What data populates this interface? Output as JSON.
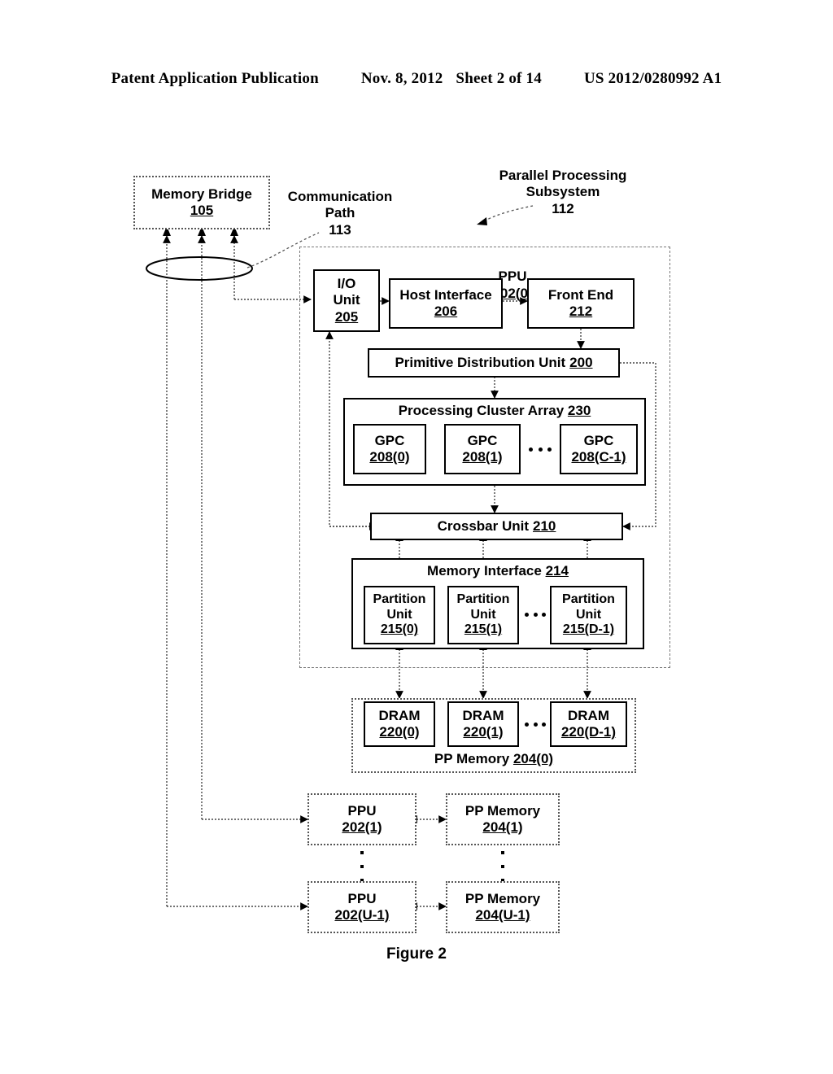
{
  "header": {
    "publication": "Patent Application Publication",
    "date": "Nov. 8, 2012",
    "sheet": "Sheet 2 of 14",
    "doc_number": "US 2012/0280992 A1"
  },
  "figure": {
    "caption": "Figure 2"
  },
  "labels": {
    "communication_path": "Communication\nPath\n113",
    "parallel_processing_subsystem": "Parallel Processing\nSubsystem\n112"
  },
  "blocks": {
    "memory_bridge": {
      "name": "Memory Bridge",
      "ref": "105"
    },
    "ppu_container": {
      "name": "PPU",
      "ref": "202(0)"
    },
    "io_unit": {
      "name": "I/O\nUnit",
      "ref": "205"
    },
    "host_interface": {
      "name": "Host Interface",
      "ref": "206"
    },
    "front_end": {
      "name": "Front End",
      "ref": "212"
    },
    "primitive_distribution_unit": {
      "name": "Primitive Distribution Unit",
      "ref": "200"
    },
    "processing_cluster_array": {
      "name": "Processing Cluster Array",
      "ref": "230"
    },
    "gpc_0": {
      "name": "GPC",
      "ref": "208(0)"
    },
    "gpc_1": {
      "name": "GPC",
      "ref": "208(1)"
    },
    "gpc_c1": {
      "name": "GPC",
      "ref": "208(C-1)"
    },
    "crossbar_unit": {
      "name": "Crossbar Unit",
      "ref": "210"
    },
    "memory_interface": {
      "name": "Memory Interface",
      "ref": "214"
    },
    "partition_0": {
      "name": "Partition\nUnit",
      "ref": "215(0)"
    },
    "partition_1": {
      "name": "Partition\nUnit",
      "ref": "215(1)"
    },
    "partition_d1": {
      "name": "Partition\nUnit",
      "ref": "215(D-1)"
    },
    "dram_0": {
      "name": "DRAM",
      "ref": "220(0)"
    },
    "dram_1": {
      "name": "DRAM",
      "ref": "220(1)"
    },
    "dram_d1": {
      "name": "DRAM",
      "ref": "220(D-1)"
    },
    "pp_memory_0": {
      "name": "PP Memory",
      "ref": "204(0)"
    },
    "ppu_1": {
      "name": "PPU",
      "ref": "202(1)"
    },
    "pp_memory_1": {
      "name": "PP Memory",
      "ref": "204(1)"
    },
    "ppu_u1": {
      "name": "PPU",
      "ref": "202(U-1)"
    },
    "pp_memory_u1": {
      "name": "PP Memory",
      "ref": "204(U-1)"
    }
  }
}
